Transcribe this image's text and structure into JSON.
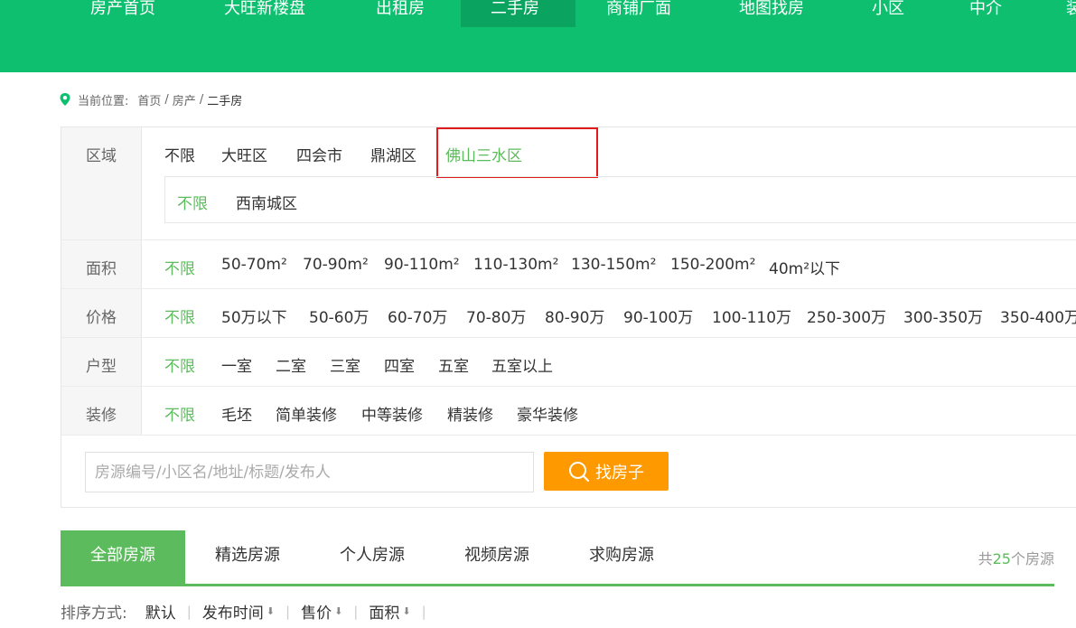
{
  "nav": {
    "items": [
      "房产首页",
      "大旺新楼盘",
      "出租房",
      "二手房",
      "商铺厂面",
      "地图找房",
      "小区",
      "中介",
      "装"
    ]
  },
  "breadcrumb": {
    "label": "当前位置:",
    "home": "首页",
    "sep": "/",
    "property": "房产",
    "current": "二手房"
  },
  "filter": {
    "region": {
      "label": "区域",
      "options": [
        "不限",
        "大旺区",
        "四会市",
        "鼎湖区",
        "佛山三水区"
      ],
      "sub_options": [
        "不限",
        "西南城区"
      ]
    },
    "area": {
      "label": "面积",
      "options": [
        "不限",
        "50-70m²",
        "70-90m²",
        "90-110m²",
        "110-130m²",
        "130-150m²",
        "150-200m²",
        "40m²以下"
      ]
    },
    "price": {
      "label": "价格",
      "options": [
        "不限",
        "50万以下",
        "50-60万",
        "60-70万",
        "70-80万",
        "80-90万",
        "90-100万",
        "100-110万",
        "250-300万",
        "300-350万",
        "350-400万"
      ]
    },
    "layout": {
      "label": "户型",
      "options": [
        "不限",
        "一室",
        "二室",
        "三室",
        "四室",
        "五室",
        "五室以上"
      ]
    },
    "decor": {
      "label": "装修",
      "options": [
        "不限",
        "毛坯",
        "简单装修",
        "中等装修",
        "精装修",
        "豪华装修"
      ]
    }
  },
  "search": {
    "placeholder": "房源编号/小区名/地址/标题/发布人",
    "button_label": "找房子"
  },
  "tabs": {
    "items": [
      "全部房源",
      "精选房源",
      "个人房源",
      "视频房源",
      "求购房源"
    ],
    "count_prefix": "共",
    "count_value": "25",
    "count_suffix": "个房源"
  },
  "sort": {
    "label": "排序方式:",
    "default": "默认",
    "time": "发布时间",
    "price": "售价",
    "area": "面积"
  },
  "colors": {
    "nav_bg": "#0dbf6f",
    "accent_green": "#5cbb5c",
    "search_button": "#ff9900",
    "highlight_box": "#e31b1b"
  }
}
